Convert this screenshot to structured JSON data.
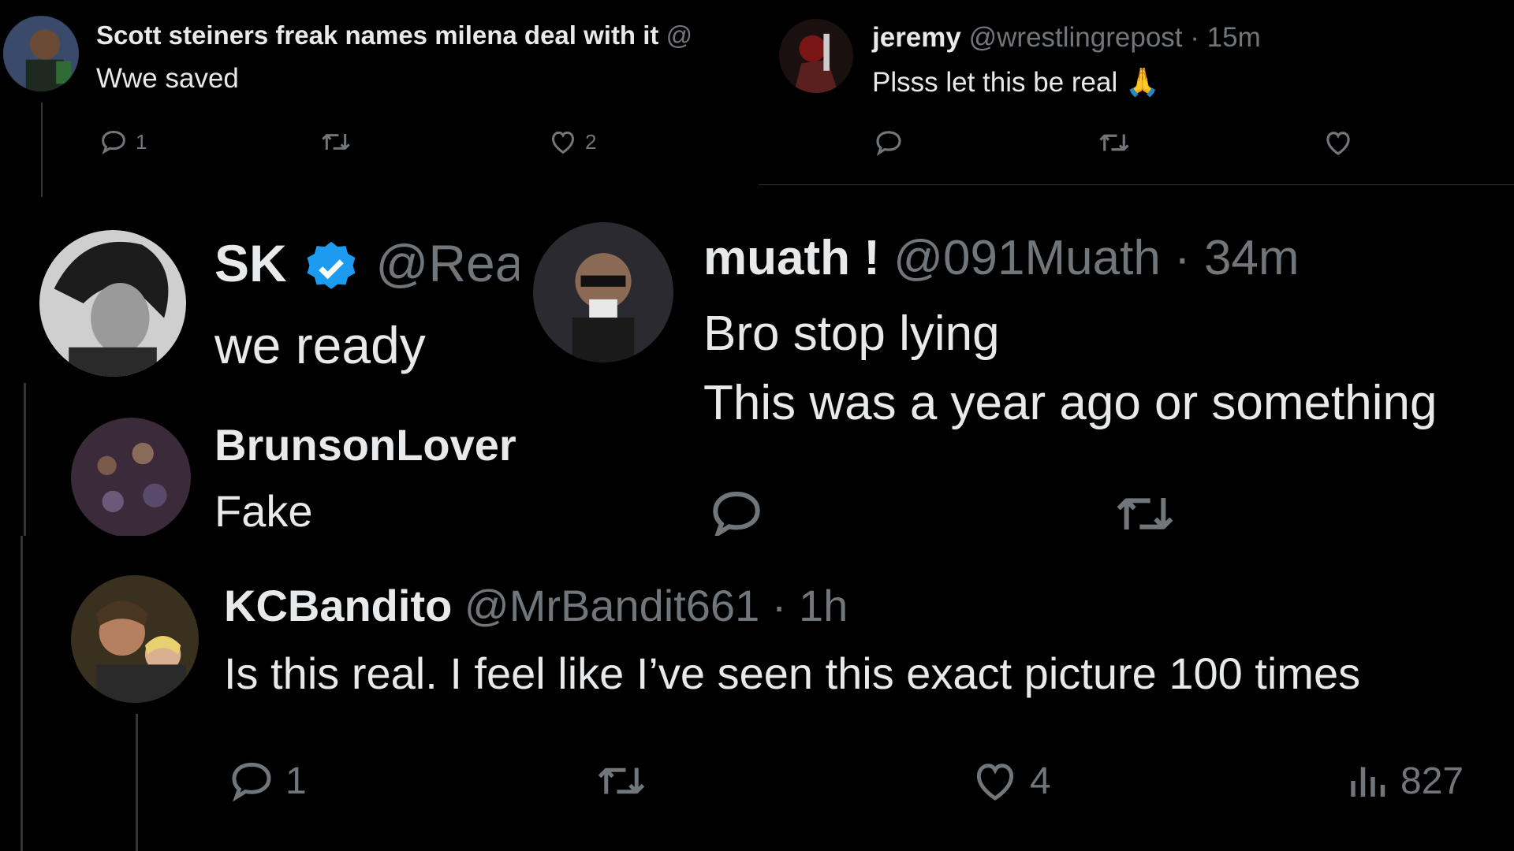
{
  "tweets": {
    "scott": {
      "display_name": "Scott steiners freak names milena deal with it",
      "handle_fragment": "@",
      "text": "Wwe saved",
      "reply_count": "1",
      "like_count": "2"
    },
    "jeremy": {
      "display_name": "jeremy",
      "handle": "@wrestlingrepost",
      "separator": "·",
      "time": "15m",
      "text": "Plsss let this be real",
      "emoji": "🙏"
    },
    "sk": {
      "display_name": "SK",
      "handle_fragment": "@Rea",
      "text": "we ready"
    },
    "brunson": {
      "display_name": "BrunsonLover",
      "text": "Fake"
    },
    "muath": {
      "display_name": "muath !",
      "handle": "@091Muath",
      "separator": "·",
      "time": "34m",
      "text_line1": "Bro stop lying",
      "text_line2": "This was a year ago or something"
    },
    "kc": {
      "display_name": "KCBandito",
      "handle": "@MrBandit661",
      "separator": "·",
      "time": "1h",
      "text": "Is this real. I feel like I’ve seen this exact picture 100 times",
      "reply_count": "1",
      "like_count": "4",
      "view_count": "827"
    }
  },
  "colors": {
    "background": "#000000",
    "text": "#e7e9ea",
    "muted": "#71767b",
    "verified": "#1d9bf0",
    "divider": "#2f3336"
  },
  "icons": [
    "reply-icon",
    "retweet-icon",
    "like-icon",
    "views-icon",
    "verified-badge-icon"
  ]
}
